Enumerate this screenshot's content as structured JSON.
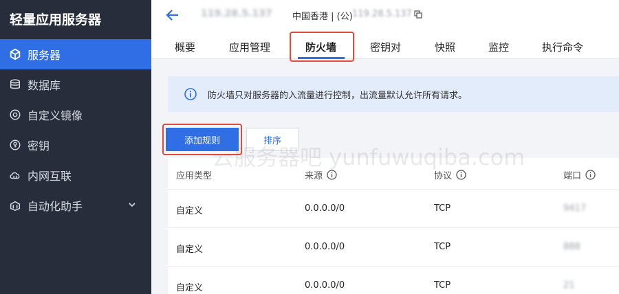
{
  "sidebar": {
    "title": "轻量应用服务器",
    "items": [
      {
        "label": "服务器",
        "icon": "cube-icon",
        "active": true
      },
      {
        "label": "数据库",
        "icon": "database-icon"
      },
      {
        "label": "自定义镜像",
        "icon": "disc-icon"
      },
      {
        "label": "密钥",
        "icon": "key-icon"
      },
      {
        "label": "内网互联",
        "icon": "cloud-link-icon"
      },
      {
        "label": "自动化助手",
        "icon": "tools-icon",
        "has_submenu": true
      }
    ]
  },
  "header": {
    "server_name": "119.28.5.137",
    "region": "中国香港 | (公)",
    "ip": "119.28.5.137",
    "tabs": [
      {
        "label": "概要"
      },
      {
        "label": "应用管理"
      },
      {
        "label": "防火墙",
        "active": true
      },
      {
        "label": "密钥对"
      },
      {
        "label": "快照"
      },
      {
        "label": "监控"
      },
      {
        "label": "执行命令"
      }
    ]
  },
  "info": {
    "text": "防火墙只对服务器的入流量进行控制，出流量默认允许所有请求。"
  },
  "actions": {
    "add_rule": "添加规则",
    "sort": "排序"
  },
  "table": {
    "columns": [
      "应用类型",
      "来源",
      "协议",
      "端口"
    ],
    "rows": [
      {
        "type": "自定义",
        "source": "0.0.0.0/0",
        "protocol": "TCP",
        "port": "9417"
      },
      {
        "type": "自定义",
        "source": "0.0.0.0/0",
        "protocol": "TCP",
        "port": "888"
      },
      {
        "type": "自定义",
        "source": "0.0.0.0/0",
        "protocol": "TCP",
        "port": "21"
      }
    ]
  },
  "watermark": "云服务器吧 yunfuwuqiba.com",
  "colors": {
    "sidebar_bg": "#272d3b",
    "accent": "#2f6ee5",
    "highlight": "#e24a3b",
    "info_bg": "#e3ecfb"
  }
}
